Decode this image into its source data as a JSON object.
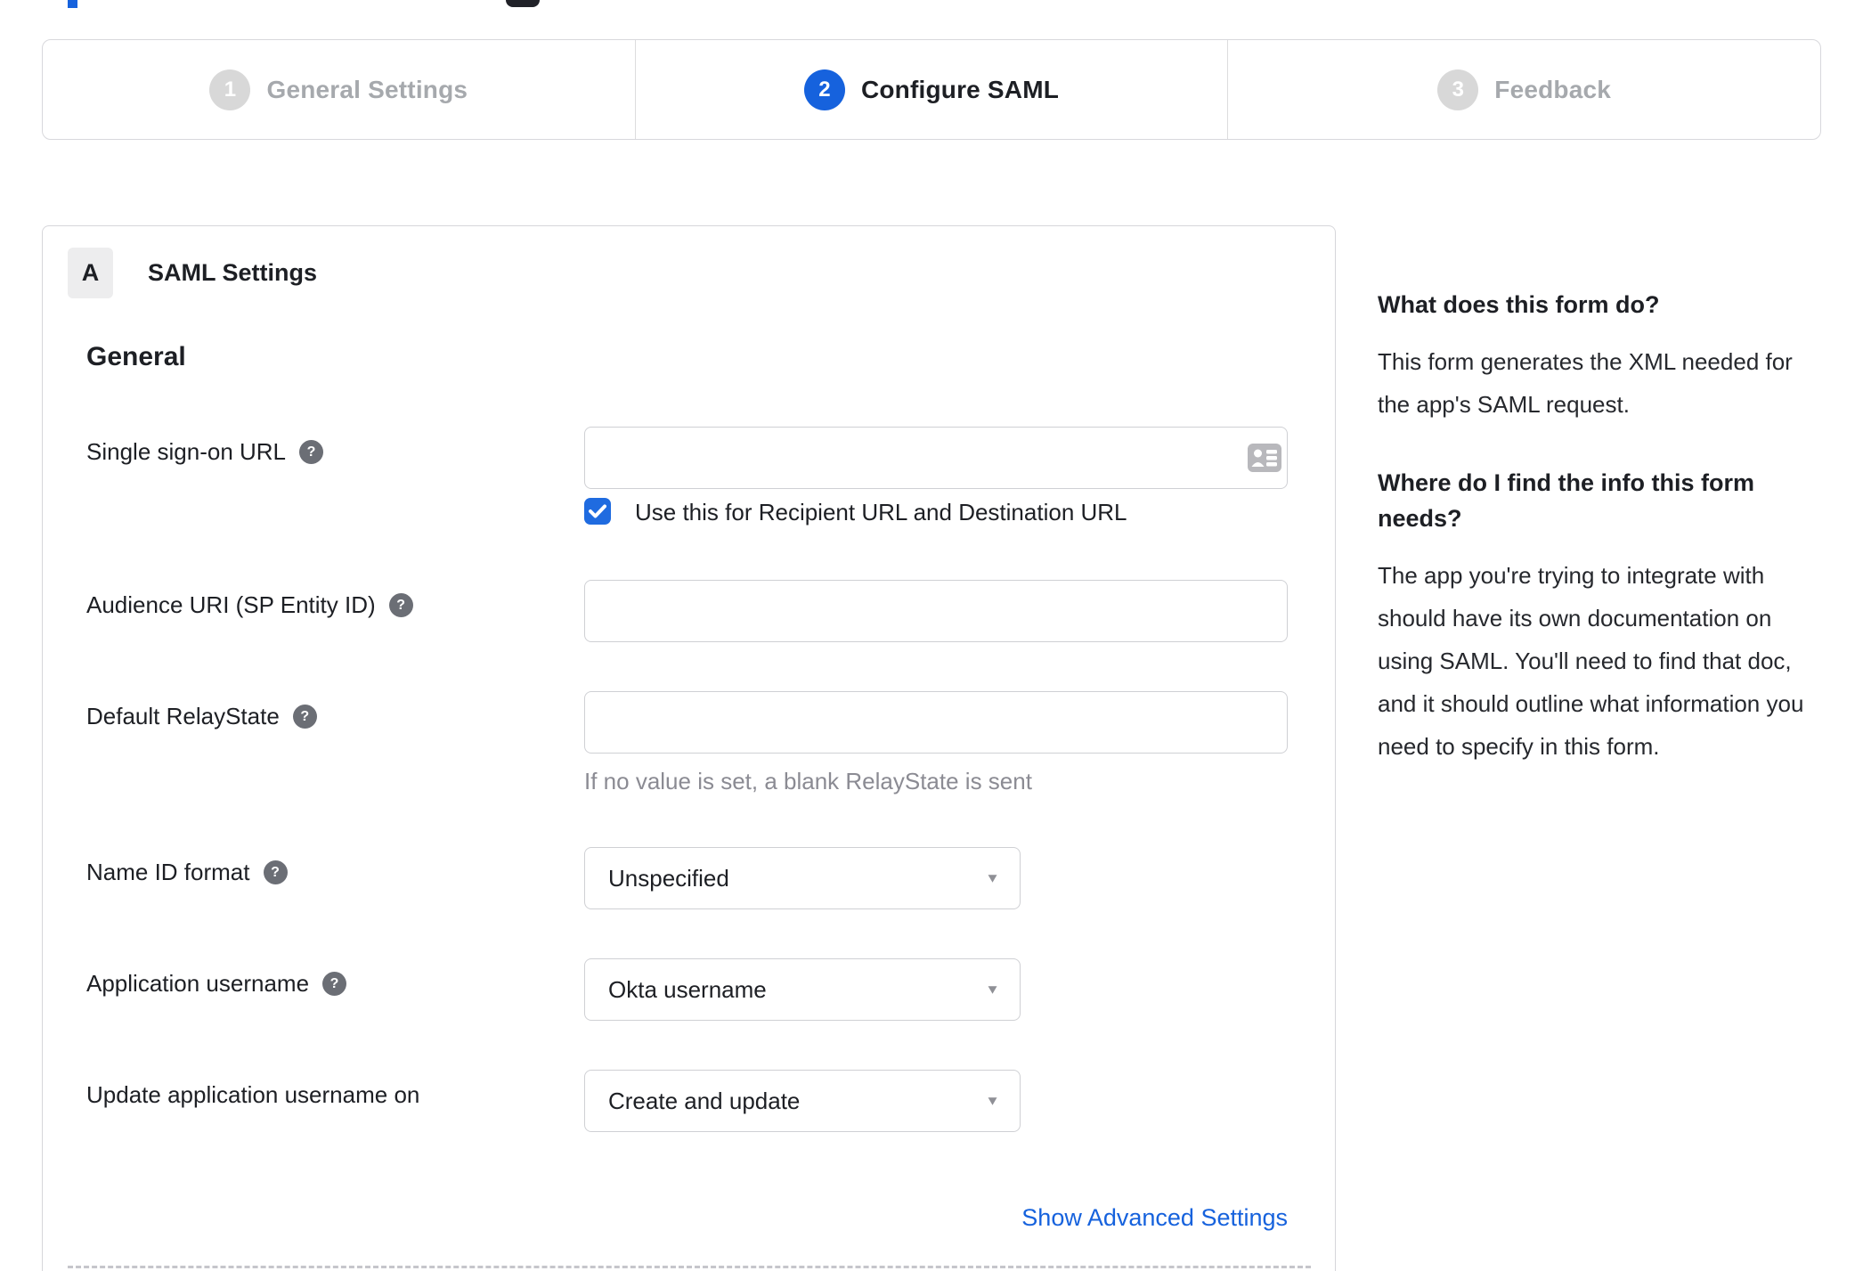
{
  "icons": {
    "help_icon": "?",
    "dropdown_caret": "▼"
  },
  "colors": {
    "accent_blue": "#1662dd",
    "checkbox_blue": "#1f6be0",
    "inactive_gray": "#d8d8d8",
    "link_blue": "#1662dd"
  },
  "stepper": {
    "steps": [
      {
        "number": "1",
        "label": "General Settings",
        "state": "inactive"
      },
      {
        "number": "2",
        "label": "Configure SAML",
        "state": "active"
      },
      {
        "number": "3",
        "label": "Feedback",
        "state": "inactive"
      }
    ]
  },
  "panel": {
    "badge": "A",
    "title": "SAML Settings",
    "section_heading": "General",
    "fields": [
      {
        "label": "Single sign-on URL",
        "value": "",
        "checkbox": {
          "checked": true,
          "label": "Use this for Recipient URL and Destination URL"
        }
      },
      {
        "label": "Audience URI (SP Entity ID)",
        "value": ""
      },
      {
        "label": "Default RelayState",
        "value": "",
        "hint": "If no value is set, a blank RelayState is sent"
      },
      {
        "label": "Name ID format",
        "value": "Unspecified"
      },
      {
        "label": "Application username",
        "value": "Okta username"
      },
      {
        "label": "Update application username on",
        "value": "Create and update"
      }
    ],
    "advanced_link": "Show Advanced Settings"
  },
  "sidebar": {
    "sections": [
      {
        "heading": "What does this form do?",
        "body": "This form generates the XML needed for the app's SAML request."
      },
      {
        "heading": "Where do I find the info this form needs?",
        "body": "The app you're trying to integrate with should have its own documentation on using SAML. You'll need to find that doc, and it should outline what information you need to specify in this form."
      }
    ]
  }
}
